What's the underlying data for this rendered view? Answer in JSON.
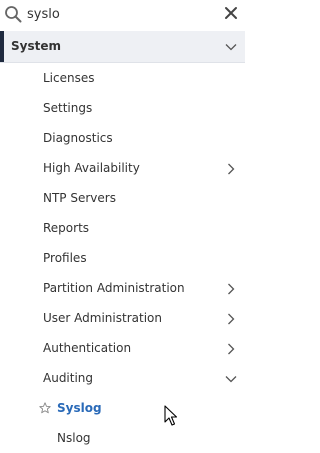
{
  "search": {
    "value": "syslo",
    "placeholder": "",
    "icon": "search-icon",
    "clear_icon": "close-icon"
  },
  "section": {
    "label": "System",
    "expanded": true
  },
  "menu": [
    {
      "label": "Licenses",
      "has_children": false
    },
    {
      "label": "Settings",
      "has_children": false
    },
    {
      "label": "Diagnostics",
      "has_children": false
    },
    {
      "label": "High Availability",
      "has_children": true,
      "expanded": false
    },
    {
      "label": "NTP Servers",
      "has_children": false
    },
    {
      "label": "Reports",
      "has_children": false
    },
    {
      "label": "Profiles",
      "has_children": false
    },
    {
      "label": "Partition Administration",
      "has_children": true,
      "expanded": false
    },
    {
      "label": "User Administration",
      "has_children": true,
      "expanded": false
    },
    {
      "label": "Authentication",
      "has_children": true,
      "expanded": false
    },
    {
      "label": "Auditing",
      "has_children": true,
      "expanded": true
    }
  ],
  "auditing_children": [
    {
      "label": "Syslog",
      "active": true,
      "favorite_icon": "star-outline-icon"
    },
    {
      "label": "Nslog",
      "active": false
    }
  ],
  "colors": {
    "accent_bar": "#1f2a3f",
    "active_link": "#2a6ab8",
    "header_bg": "#eef0f4",
    "text": "#333333",
    "chevron": "#555555"
  }
}
